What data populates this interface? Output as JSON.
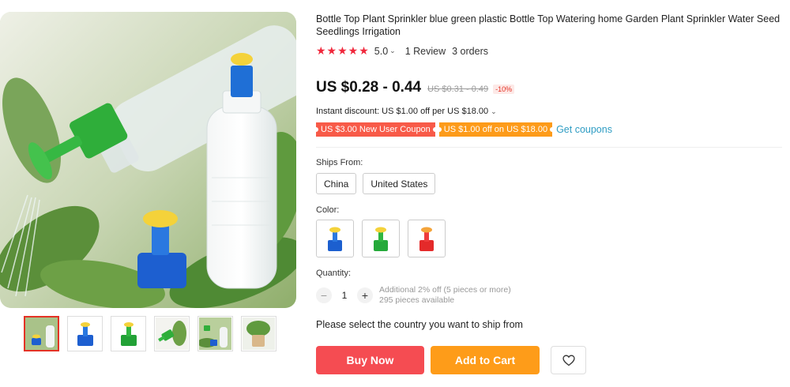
{
  "product": {
    "title": "Bottle Top Plant Sprinkler blue green plastic Bottle Top Watering home Garden Plant Sprinkler Water Seed Seedlings Irrigation"
  },
  "rating": {
    "stars": "★★★★★",
    "value": "5.0",
    "reviews": "1 Review",
    "orders": "3 orders"
  },
  "price": {
    "current": "US $0.28 - 0.44",
    "original": "US $0.31 - 0.49",
    "discount": "-10%"
  },
  "instant_discount": "Instant discount: US $1.00 off per US $18.00",
  "coupons": {
    "new_user": "US $3.00 New User Coupon",
    "store": "US $1.00 off on US $18.00",
    "get_label": "Get coupons"
  },
  "ships_from": {
    "label": "Ships From:",
    "options": [
      "China",
      "United States"
    ]
  },
  "color": {
    "label": "Color:",
    "options": [
      {
        "name": "blue",
        "cap": "#1c5fcf",
        "top": "#f4d23a"
      },
      {
        "name": "green",
        "cap": "#25a93a",
        "top": "#f4d23a"
      },
      {
        "name": "red",
        "cap": "#e42a2a",
        "top": "#f4a43a"
      }
    ]
  },
  "quantity": {
    "label": "Quantity:",
    "value": "1",
    "minus": "−",
    "plus": "+",
    "note_discount": "Additional 2% off (5 pieces or more)",
    "note_available": "295 pieces available"
  },
  "shipping_message": "Please select the country you want to ship from",
  "actions": {
    "buy_now": "Buy Now",
    "add_to_cart": "Add to Cart"
  },
  "colors": {
    "accent_red": "#f54c52",
    "accent_orange": "#fe9c19",
    "link_blue": "#2e9cc3",
    "star_red": "#f0283c"
  }
}
